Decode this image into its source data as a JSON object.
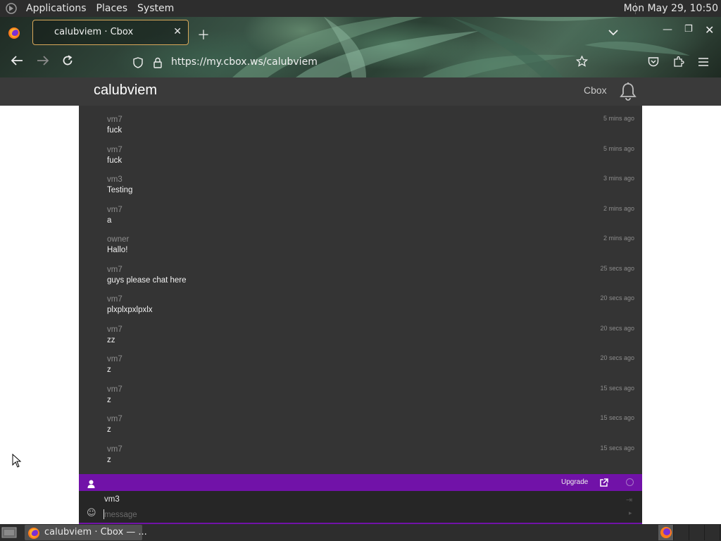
{
  "top_panel": {
    "menus": [
      "Applications",
      "Places",
      "System"
    ],
    "clock": "Mon May 29, 10:50"
  },
  "browser": {
    "tab_title": "calubviem · Cbox",
    "url": "https://my.cbox.ws/calubviem"
  },
  "site": {
    "title": "calubviem",
    "nav_link": "Cbox"
  },
  "messages": [
    {
      "user": "vm7",
      "text": "fuck",
      "time": "5 mins ago"
    },
    {
      "user": "vm7",
      "text": "fuck",
      "time": "5 mins ago"
    },
    {
      "user": "vm3",
      "text": "Testing",
      "time": "3 mins ago"
    },
    {
      "user": "vm7",
      "text": "a",
      "time": "2 mins ago"
    },
    {
      "user": "owner",
      "text": "Hallo!",
      "time": "2 mins ago"
    },
    {
      "user": "vm7",
      "text": "guys please chat here",
      "time": "25 secs ago"
    },
    {
      "user": "vm7",
      "text": "plxplxpxlpxlx",
      "time": "20 secs ago"
    },
    {
      "user": "vm7",
      "text": "zz",
      "time": "20 secs ago"
    },
    {
      "user": "vm7",
      "text": "z",
      "time": "20 secs ago"
    },
    {
      "user": "vm7",
      "text": "z",
      "time": "15 secs ago"
    },
    {
      "user": "vm7",
      "text": "z",
      "time": "15 secs ago"
    },
    {
      "user": "vm7",
      "text": "z",
      "time": "15 secs ago"
    }
  ],
  "cbox_bar": {
    "upgrade_label": "Upgrade",
    "accent_color": "#7112a8"
  },
  "composer": {
    "name_value": "vm3",
    "message_placeholder": "message"
  },
  "taskbar": {
    "task_label": "calubviem · Cbox — ..."
  }
}
